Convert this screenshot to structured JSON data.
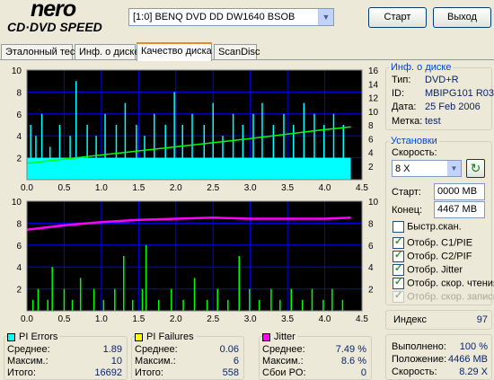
{
  "app": {
    "logo_main": "nero",
    "logo_sub": "CD·DVD SPEED"
  },
  "drive": {
    "selected": "[1:0]  BENQ DVD DD DW1640 BSOB"
  },
  "buttons": {
    "start": "Старт",
    "exit": "Выход"
  },
  "tabs": [
    {
      "label": "Эталонный тест",
      "active": false
    },
    {
      "label": "Инф. о диске",
      "active": false
    },
    {
      "label": "Качество диска",
      "active": true
    },
    {
      "label": "ScanDisc",
      "active": false
    }
  ],
  "disc_info": {
    "title": "Инф. о диске",
    "type_label": "Тип:",
    "type_value": "DVD+R",
    "id_label": "ID:",
    "id_value": "MBIPG101 R03",
    "date_label": "Дата:",
    "date_value": "25 Feb 2006",
    "mark_label": "Метка:",
    "mark_value": "test"
  },
  "settings": {
    "title": "Установки",
    "speed_label": "Скорость:",
    "speed_value": "8 X",
    "start_label": "Старт:",
    "start_value": "0000 MB",
    "end_label": "Конец:",
    "end_value": "4467 MB",
    "options": [
      {
        "label": "Быстр.скан.",
        "checked": false,
        "disabled": false
      },
      {
        "label": "Отобр. C1/PIE",
        "checked": true,
        "disabled": false
      },
      {
        "label": "Отобр. C2/PIF",
        "checked": true,
        "disabled": false
      },
      {
        "label": "Отобр. Jitter",
        "checked": true,
        "disabled": false
      },
      {
        "label": "Отобр. скор. чтения",
        "checked": true,
        "disabled": false
      },
      {
        "label": "Отобр. скор. записи",
        "checked": true,
        "disabled": true
      }
    ]
  },
  "index": {
    "label": "Индекс",
    "value": "97"
  },
  "progress": {
    "done_label": "Выполнено:",
    "done_value": "100 %",
    "pos_label": "Положение:",
    "pos_value": "4466 MB",
    "speed_label": "Скорость:",
    "speed_value": "8.29 X"
  },
  "stats": {
    "pi_errors": {
      "title": "PI Errors",
      "color": "#00ffff",
      "rows": [
        [
          "Среднее:",
          "1.89"
        ],
        [
          "Максим.:",
          "10"
        ],
        [
          "Итого:",
          "16692"
        ]
      ]
    },
    "pi_failures": {
      "title": "PI Failures",
      "color": "#ffff00",
      "rows": [
        [
          "Среднее:",
          "0.06"
        ],
        [
          "Максим.:",
          "6"
        ],
        [
          "Итого:",
          "558"
        ]
      ]
    },
    "jitter": {
      "title": "Jitter",
      "color": "#ff00ff",
      "rows": [
        [
          "Среднее:",
          "7.49 %"
        ],
        [
          "Максим.:",
          "8.6 %"
        ],
        [
          "Сбои PO:",
          "0"
        ]
      ]
    }
  },
  "colors": {
    "pie": "#00ffff",
    "pif": "#00ff00",
    "jitter": "#ff00ff",
    "speed": "#00ff00",
    "grid": "#0000ff",
    "background": "#000000"
  },
  "chart_data": [
    {
      "type": "area",
      "x_ticks": [
        "0.0",
        "0.5",
        "1.0",
        "1.5",
        "2.0",
        "2.5",
        "3.0",
        "3.5",
        "4.0",
        "4.5"
      ],
      "xlim": [
        0,
        4.5
      ],
      "y_left_ticks": [
        "2",
        "4",
        "6",
        "8",
        "10"
      ],
      "ylim_left": [
        0,
        10
      ],
      "y_right_ticks": [
        "2",
        "4",
        "6",
        "8",
        "10",
        "12",
        "14",
        "16"
      ],
      "ylim_right": [
        0,
        16
      ],
      "grid": true,
      "series": [
        {
          "name": "PI Errors",
          "color": "#00ffff",
          "baseline_y": 2.0,
          "x": [
            0.05,
            0.12,
            0.2,
            0.31,
            0.44,
            0.58,
            0.66,
            0.81,
            0.93,
            1.05,
            1.2,
            1.32,
            1.47,
            1.58,
            1.71,
            1.86,
            1.98,
            2.09,
            2.22,
            2.38,
            2.5,
            2.63,
            2.77,
            2.9,
            3.04,
            3.16,
            3.31,
            3.45,
            3.58,
            3.72,
            3.86,
            3.99,
            4.12,
            4.25
          ],
          "y": [
            5,
            4,
            6,
            3,
            5,
            4,
            9,
            5,
            4,
            6,
            5,
            7,
            5,
            4,
            6,
            5,
            8,
            5,
            6,
            5,
            7,
            4,
            6,
            5,
            6,
            7,
            5,
            6,
            5,
            7,
            6,
            5,
            6,
            5
          ]
        },
        {
          "color": "#00ff00",
          "axis": "right",
          "x": [
            0,
            1.0,
            2.0,
            3.0,
            4.0,
            4.35
          ],
          "y": [
            2.4,
            3.6,
            4.8,
            6.0,
            7.3,
            7.7
          ]
        }
      ]
    },
    {
      "type": "bar",
      "x_ticks": [
        "0.0",
        "0.5",
        "1.0",
        "1.5",
        "2.0",
        "2.5",
        "3.0",
        "3.5",
        "4.0",
        "4.5"
      ],
      "xlim": [
        0,
        4.5
      ],
      "y_left_ticks": [
        "2",
        "4",
        "6",
        "8",
        "10"
      ],
      "ylim_left": [
        0,
        10
      ],
      "y_right_ticks": [
        "2",
        "4",
        "6",
        "8",
        "10"
      ],
      "ylim_right": [
        0,
        10
      ],
      "grid": true,
      "series": [
        {
          "name": "PI Failures",
          "color": "#00ff00",
          "x": [
            0.08,
            0.15,
            0.28,
            0.34,
            0.5,
            0.61,
            0.72,
            0.9,
            1.03,
            1.18,
            1.3,
            1.42,
            1.55,
            1.6,
            1.77,
            1.94,
            2.1,
            2.25,
            2.42,
            2.56,
            2.7,
            2.85,
            2.99,
            3.12,
            3.28,
            3.4,
            3.55,
            3.7,
            3.83,
            3.98,
            4.1,
            4.24
          ],
          "y": [
            1,
            2,
            1,
            4,
            2,
            1,
            3,
            2,
            1,
            2,
            5,
            1,
            2,
            6,
            1,
            2,
            1,
            3,
            1,
            2,
            1,
            5,
            2,
            1,
            2,
            1,
            2,
            1,
            2,
            1,
            2,
            1
          ]
        },
        {
          "name": "Jitter",
          "color": "#ff00ff",
          "axis": "right",
          "x": [
            0,
            0.5,
            1.0,
            1.5,
            2.0,
            2.5,
            3.0,
            3.5,
            4.0,
            4.35
          ],
          "y": [
            7.4,
            7.8,
            8.1,
            8.3,
            8.4,
            8.5,
            8.4,
            8.4,
            8.4,
            8.5
          ]
        }
      ]
    }
  ]
}
